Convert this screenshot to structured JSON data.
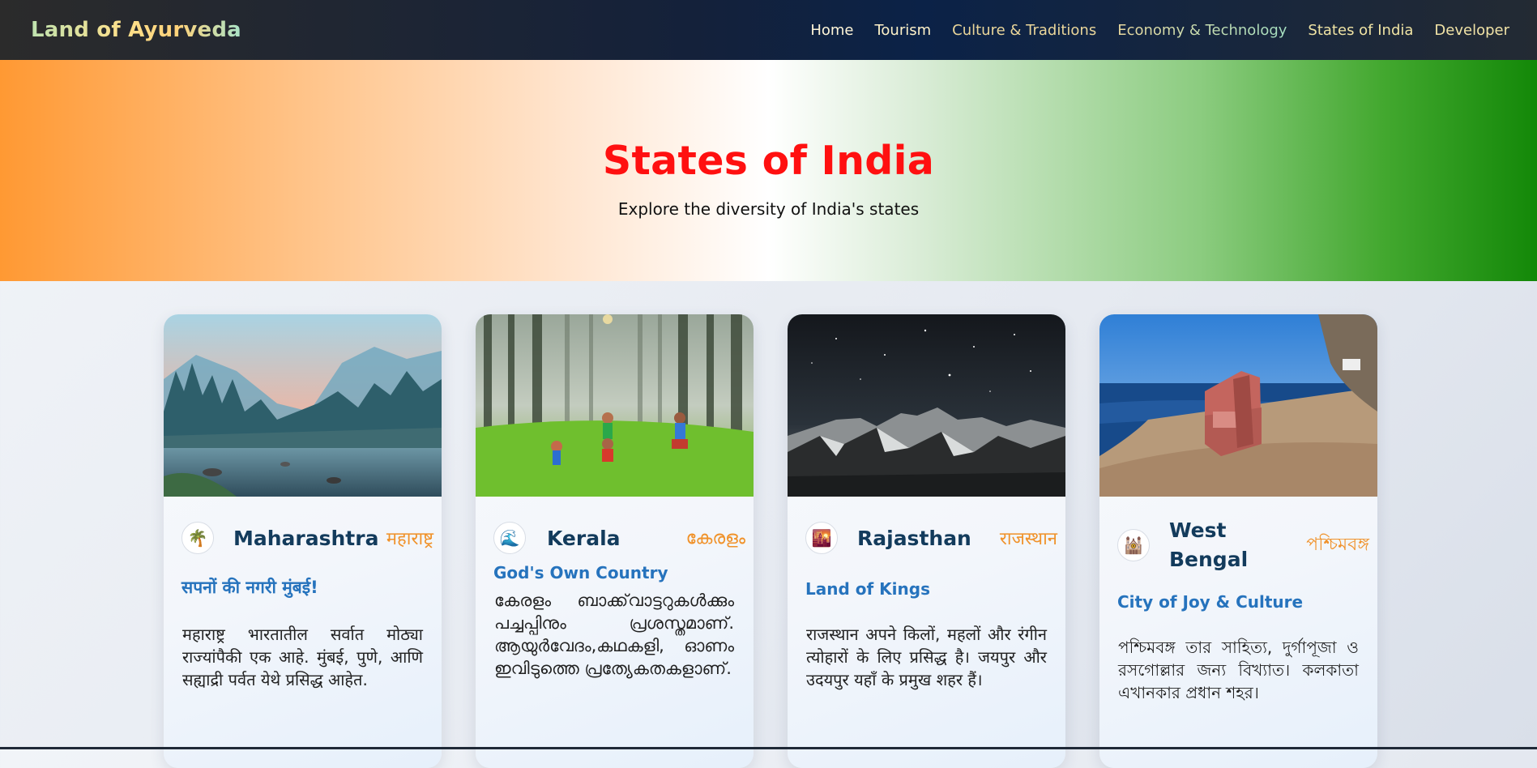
{
  "brand": "Land of Ayurveda",
  "nav": {
    "home": "Home",
    "tourism": "Tourism",
    "culture": "Culture & Traditions",
    "economy": "Economy & Technology",
    "states": "States of India",
    "developer": "Developer"
  },
  "hero": {
    "title": "States of India",
    "subtitle": "Explore the diversity of India's states"
  },
  "colors": {
    "saffron": "#ff9933",
    "green": "#138808",
    "title_red": "#ff1010",
    "state_name": "#133b5c",
    "native_name": "#f0922a",
    "tagline": "#2673bd"
  },
  "cards": [
    {
      "icon": "🌴",
      "icon_name": "palm-tree-icon",
      "name": "Maharashtra",
      "native": "महाराष्ट्र",
      "tagline": "सपनों की नगरी मुंबई!",
      "description": "महाराष्ट्र भारतातील सर्वात मोठ्या राज्यांपैकी एक आहे. मुंबई, पुणे, आणि सह्याद्री पर्वत येथे प्रसिद्ध आहेत."
    },
    {
      "icon": "🌊",
      "icon_name": "wave-icon",
      "name": "Kerala",
      "native": "കേരളം",
      "tagline": "God's Own Country",
      "description": "കേരളം ബാക്ക്‌വാട്ടറുകൾക്കും പച്ചപ്പിനും പ്രശസ്തമാണ്. ആയുർവേദം,കഥകളി, ഓണം ഇവിടുത്തെ പ്രത്യേകതകളാണ്."
    },
    {
      "icon": "🌇",
      "icon_name": "sunset-icon",
      "name": "Rajasthan",
      "native": "राजस्थान",
      "tagline": "Land of Kings",
      "description": "राजस्थान अपने किलों, महलों और रंगीन त्योहारों के लिए प्रसिद्ध है। जयपुर और उदयपुर यहाँ के प्रमुख शहर हैं।"
    },
    {
      "icon": "🕍",
      "icon_name": "temple-icon",
      "name": "West Bengal",
      "native": "পশ্চিমবঙ্গ",
      "tagline": "City of Joy & Culture",
      "description": "পশ্চিমবঙ্গ তার সাহিত্য, দুর্গাপূজা ও রসগোল্লার জন্য বিখ্যাত। কলকাতা এখানকার প্রধান শহর।"
    }
  ]
}
